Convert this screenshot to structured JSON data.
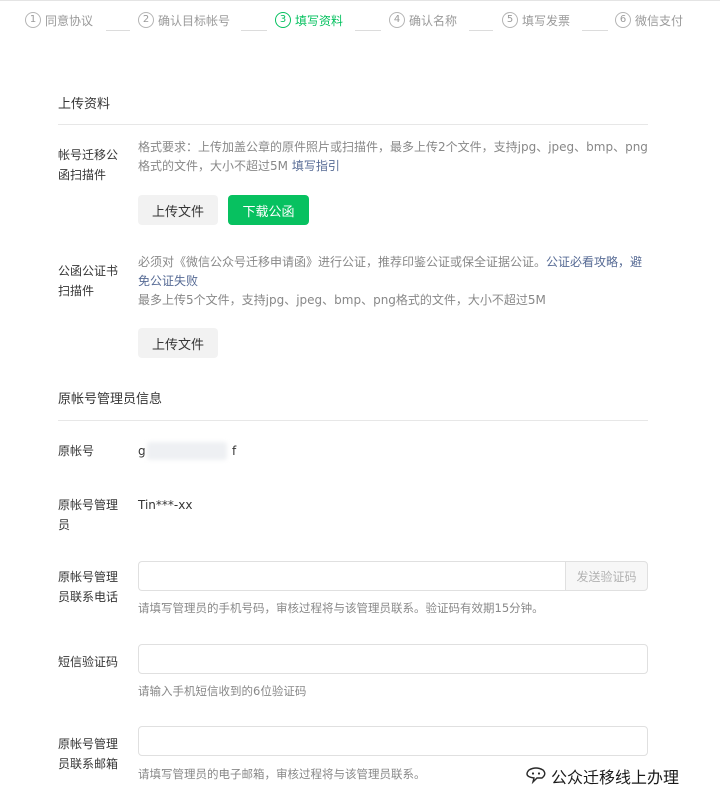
{
  "steps": [
    {
      "num": "1",
      "label": "同意协议",
      "active": false
    },
    {
      "num": "2",
      "label": "确认目标帐号",
      "active": false
    },
    {
      "num": "3",
      "label": "填写资料",
      "active": true
    },
    {
      "num": "4",
      "label": "确认名称",
      "active": false
    },
    {
      "num": "5",
      "label": "填写发票",
      "active": false
    },
    {
      "num": "6",
      "label": "微信支付",
      "active": false
    }
  ],
  "upload_section": {
    "title": "上传资料",
    "migration_letter": {
      "label": "帐号迁移公函扫描件",
      "desc": "格式要求：上传加盖公章的原件照片或扫描件，最多上传2个文件，支持jpg、jpeg、bmp、png格式的文件，大小不超过5M",
      "link": "填写指引",
      "upload_button": "上传文件",
      "download_button": "下载公函"
    },
    "notary": {
      "label": "公函公证书扫描件",
      "desc_part1": "必须对《微信公众号迁移申请函》进行公证，推荐印鉴公证或保全证据公证。",
      "link": "公证必看攻略，避免公证失败",
      "desc_part2": "最多上传5个文件，支持jpg、jpeg、bmp、png格式的文件，大小不超过5M",
      "upload_button": "上传文件"
    }
  },
  "admin_section": {
    "title": "原帐号管理员信息",
    "account": {
      "label": "原帐号",
      "value_start": "g",
      "value_end": "f"
    },
    "admin_name": {
      "label": "原帐号管理员",
      "value": "Tin***-xx"
    },
    "phone": {
      "label": "原帐号管理员联系电话",
      "value": "",
      "send_code": "发送验证码",
      "hint": "请填写管理员的手机号码，审核过程将与该管理员联系。验证码有效期15分钟。"
    },
    "sms_code": {
      "label": "短信验证码",
      "value": "",
      "hint": "请输入手机短信收到的6位验证码"
    },
    "email": {
      "label": "原帐号管理员联系邮箱",
      "value": "",
      "hint": "请填写管理员的电子邮箱，审核过程将与该管理员联系。"
    }
  },
  "watermark": {
    "text": "公众迁移线上办理",
    "icon": "wechat-official-account-icon"
  },
  "colors": {
    "accent": "#07c160",
    "link": "#576b95"
  }
}
